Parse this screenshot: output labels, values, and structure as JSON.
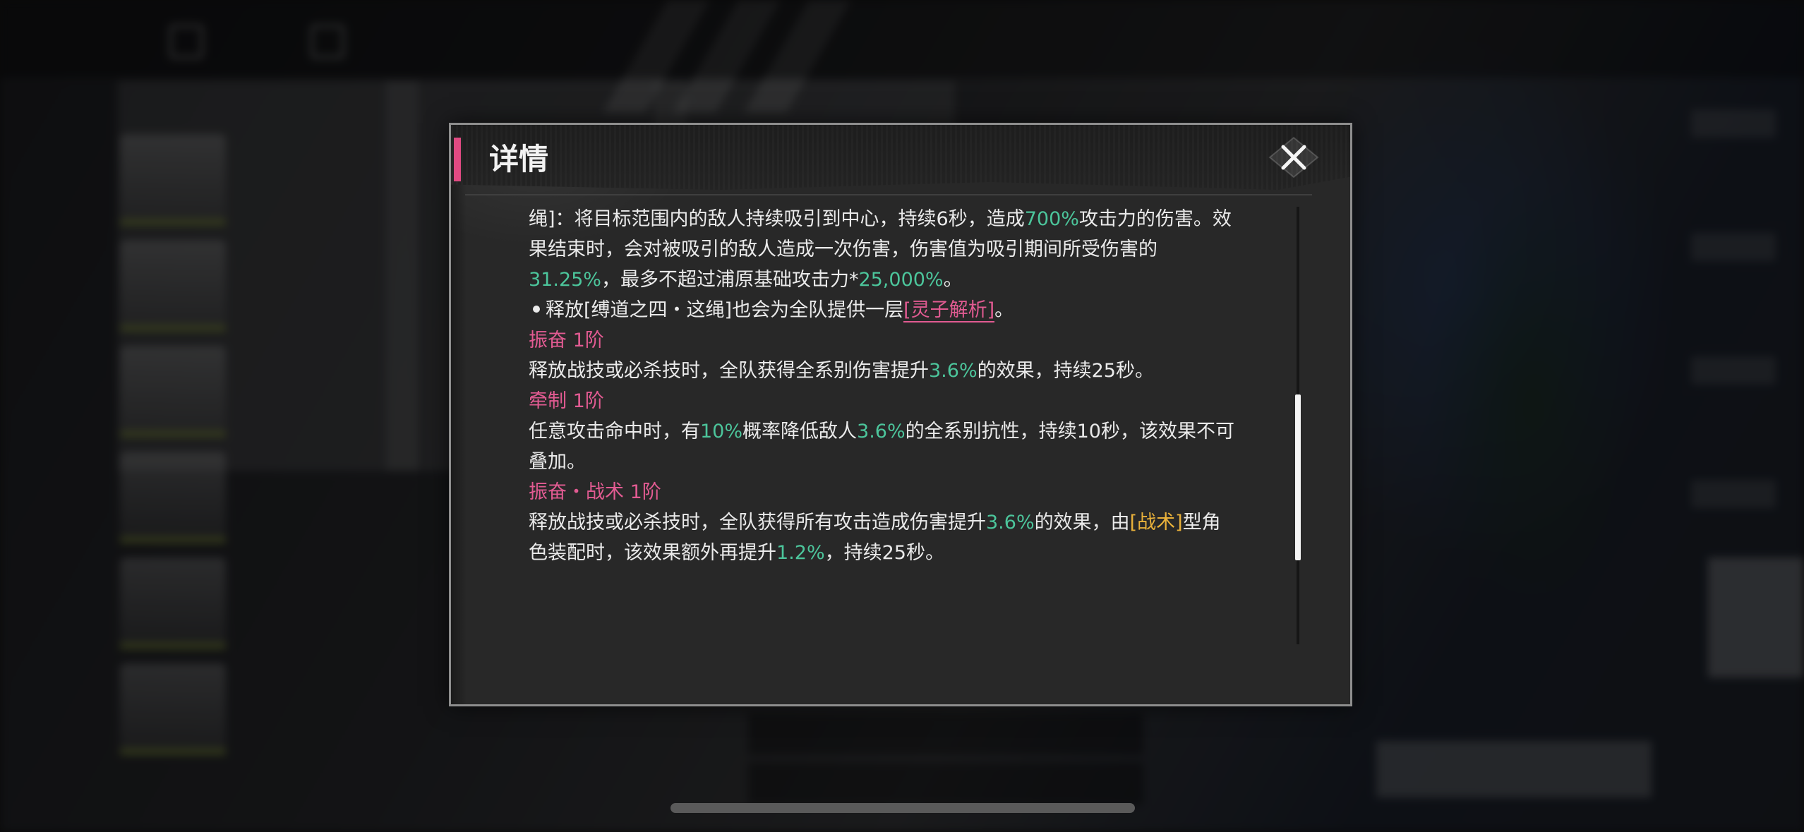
{
  "dialog": {
    "title": "详情",
    "close_icon": "close-x-icon",
    "accent_color": "#e04a82",
    "intro": {
      "line1": {
        "a": "绳]：将目标范围内的敌人持续吸引到中心，持续6秒，造成",
        "b": "700%",
        "c": "攻击力的伤害。效"
      },
      "line2": "果结束时，会对被吸引的敌人造成一次伤害，伤害值为吸引期间所受伤害的",
      "line3": {
        "a": "31.25%",
        "b": "，最多不超过浦原基础攻击力*",
        "c": "25,000%",
        "d": "。"
      },
      "line4": {
        "a": "释放[缚道之四・这绳]也会为全队提供一层",
        "link": "[灵子解析]",
        "c": "。"
      }
    },
    "sections": [
      {
        "title": "振奋 1阶",
        "desc": {
          "a": "释放战技或必杀技时，全队获得全系别伤害提升",
          "b": "3.6%",
          "c": "的效果，持续25秒。"
        }
      },
      {
        "title": "牵制 1阶",
        "desc": {
          "a": "任意攻击命中时，有",
          "b": "10%",
          "c": "概率降低敌人",
          "d": "3.6%",
          "e": "的全系别抗性，持续10秒，该效果不可",
          "line2": "叠加。"
        }
      },
      {
        "title": "振奋・战术 1阶",
        "desc": {
          "a": "释放战技或必杀技时，全队获得所有攻击造成伤害提升",
          "b": "3.6%",
          "c": "的效果，由",
          "tag": "[战术]",
          "e": "型角",
          "line2a": "色装配时，该效果额外再提升",
          "line2b": "1.2%",
          "line2c": "，持续25秒。"
        }
      }
    ],
    "colors": {
      "highlight_value": "#4cc59b",
      "highlight_keyword": "#e25b92",
      "highlight_tag": "#e9b13a"
    }
  }
}
